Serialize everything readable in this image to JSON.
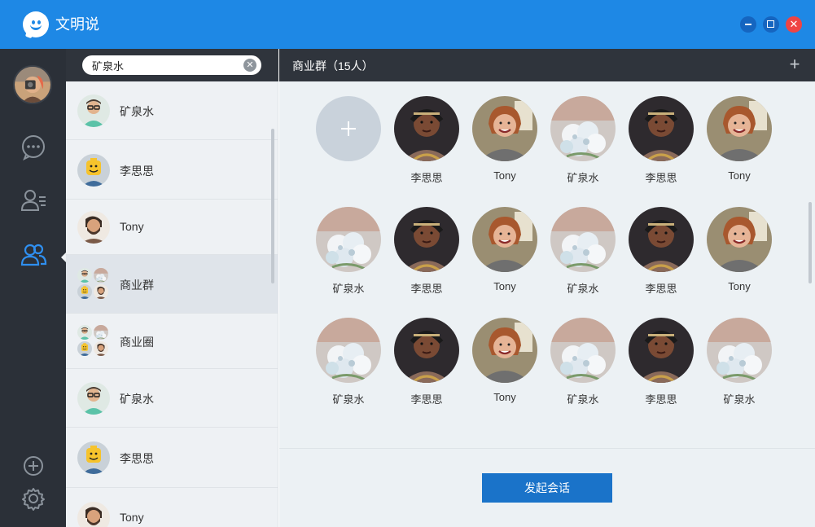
{
  "app": {
    "title": "文明说"
  },
  "colors": {
    "brand": "#1e88e5",
    "nav_bg": "#2b3038",
    "header_bg": "#2f343c",
    "accent": "#1a73c9",
    "close": "#ef4444"
  },
  "search": {
    "value": "矿泉水",
    "placeholder": ""
  },
  "contacts": [
    {
      "name": "矿泉水",
      "avatar": "man-glasses"
    },
    {
      "name": "李思思",
      "avatar": "lego-head"
    },
    {
      "name": "Tony",
      "avatar": "man-beard"
    },
    {
      "name": "商业群",
      "avatar": "group",
      "active": true
    },
    {
      "name": "商业圈",
      "avatar": "group"
    },
    {
      "name": "矿泉水",
      "avatar": "man-glasses"
    },
    {
      "name": "李思思",
      "avatar": "lego-head"
    },
    {
      "name": "Tony",
      "avatar": "man-beard"
    }
  ],
  "group": {
    "title": "商业群（15人）",
    "members": [
      {
        "name": "李思思",
        "avatar": "woman-dark"
      },
      {
        "name": "Tony",
        "avatar": "woman-smile"
      },
      {
        "name": "矿泉水",
        "avatar": "flowers"
      },
      {
        "name": "李思思",
        "avatar": "woman-dark"
      },
      {
        "name": "Tony",
        "avatar": "woman-smile"
      },
      {
        "name": "矿泉水",
        "avatar": "flowers"
      },
      {
        "name": "李思思",
        "avatar": "woman-dark"
      },
      {
        "name": "Tony",
        "avatar": "woman-smile"
      },
      {
        "name": "矿泉水",
        "avatar": "flowers"
      },
      {
        "name": "李思思",
        "avatar": "woman-dark"
      },
      {
        "name": "Tony",
        "avatar": "woman-smile"
      },
      {
        "name": "矿泉水",
        "avatar": "flowers"
      },
      {
        "name": "李思思",
        "avatar": "woman-dark"
      },
      {
        "name": "Tony",
        "avatar": "woman-smile"
      },
      {
        "name": "矿泉水",
        "avatar": "flowers"
      },
      {
        "name": "李思思",
        "avatar": "woman-dark"
      },
      {
        "name": "矿泉水",
        "avatar": "flowers"
      }
    ]
  },
  "actions": {
    "start_chat": "发起会话"
  },
  "icons": {
    "window": [
      "minimize-icon",
      "maximize-icon",
      "close-icon"
    ],
    "nav": [
      "chat-bubble-icon",
      "contacts-list-icon",
      "group-icon",
      "add-circle-icon",
      "settings-gear-icon"
    ]
  }
}
